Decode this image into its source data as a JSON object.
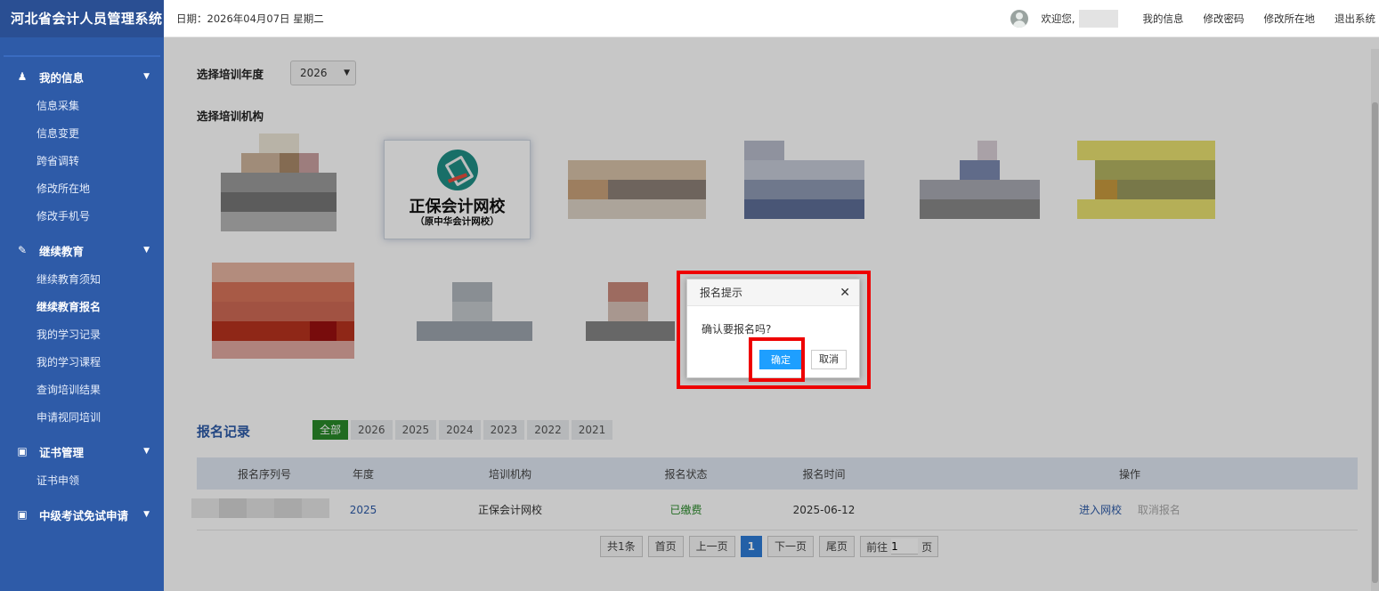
{
  "app": {
    "title": "河北省会计人员管理系统"
  },
  "header": {
    "date": "日期：2026年04月07日 星期二",
    "welcome": "欢迎您,",
    "links": [
      "我的信息",
      "修改密码",
      "修改所在地",
      "退出系统"
    ]
  },
  "sidebar": {
    "groups": [
      {
        "label": "我的信息",
        "icon": "user-icon",
        "items": [
          "信息采集",
          "信息变更",
          "跨省调转",
          "修改所在地",
          "修改手机号"
        ]
      },
      {
        "label": "继续教育",
        "icon": "edit-icon",
        "items": [
          "继续教育须知",
          "继续教育报名",
          "我的学习记录",
          "我的学习课程",
          "查询培训结果",
          "申请视同培训"
        ],
        "active_item": "继续教育报名"
      },
      {
        "label": "证书管理",
        "icon": "card-icon",
        "items": [
          "证书申领"
        ]
      },
      {
        "label": "中级考试免试申请",
        "icon": "card-icon",
        "items": []
      }
    ]
  },
  "main": {
    "year_label": "选择培训年度",
    "year_value": "2026",
    "org_label": "选择培训机构",
    "featured_org": {
      "name": "正保会计网校",
      "sub": "（原中华会计网校）"
    },
    "records_title": "报名记录",
    "year_tabs": [
      "全部",
      "2026",
      "2025",
      "2024",
      "2023",
      "2022",
      "2021"
    ],
    "table": {
      "headers": [
        "报名序列号",
        "年度",
        "培训机构",
        "报名状态",
        "报名时间",
        "操作"
      ],
      "rows": [
        {
          "year": "2025",
          "org": "正保会计网校",
          "status": "已缴费",
          "time": "2025-06-12",
          "action1": "进入网校",
          "action2": "取消报名"
        }
      ]
    },
    "pager": {
      "total": "共1条",
      "first": "首页",
      "prev": "上一页",
      "current": "1",
      "next": "下一页",
      "last": "尾页",
      "goto_prefix": "前往",
      "goto_value": "1",
      "goto_suffix": "页"
    }
  },
  "dialog": {
    "title": "报名提示",
    "message": "确认要报名吗?",
    "ok": "确定",
    "cancel": "取消"
  },
  "colors": {
    "sidebar": "#2e5ba8",
    "accent": "#1e9fff",
    "active_tab": "#2a8a2a",
    "highlight": "#e00000"
  }
}
